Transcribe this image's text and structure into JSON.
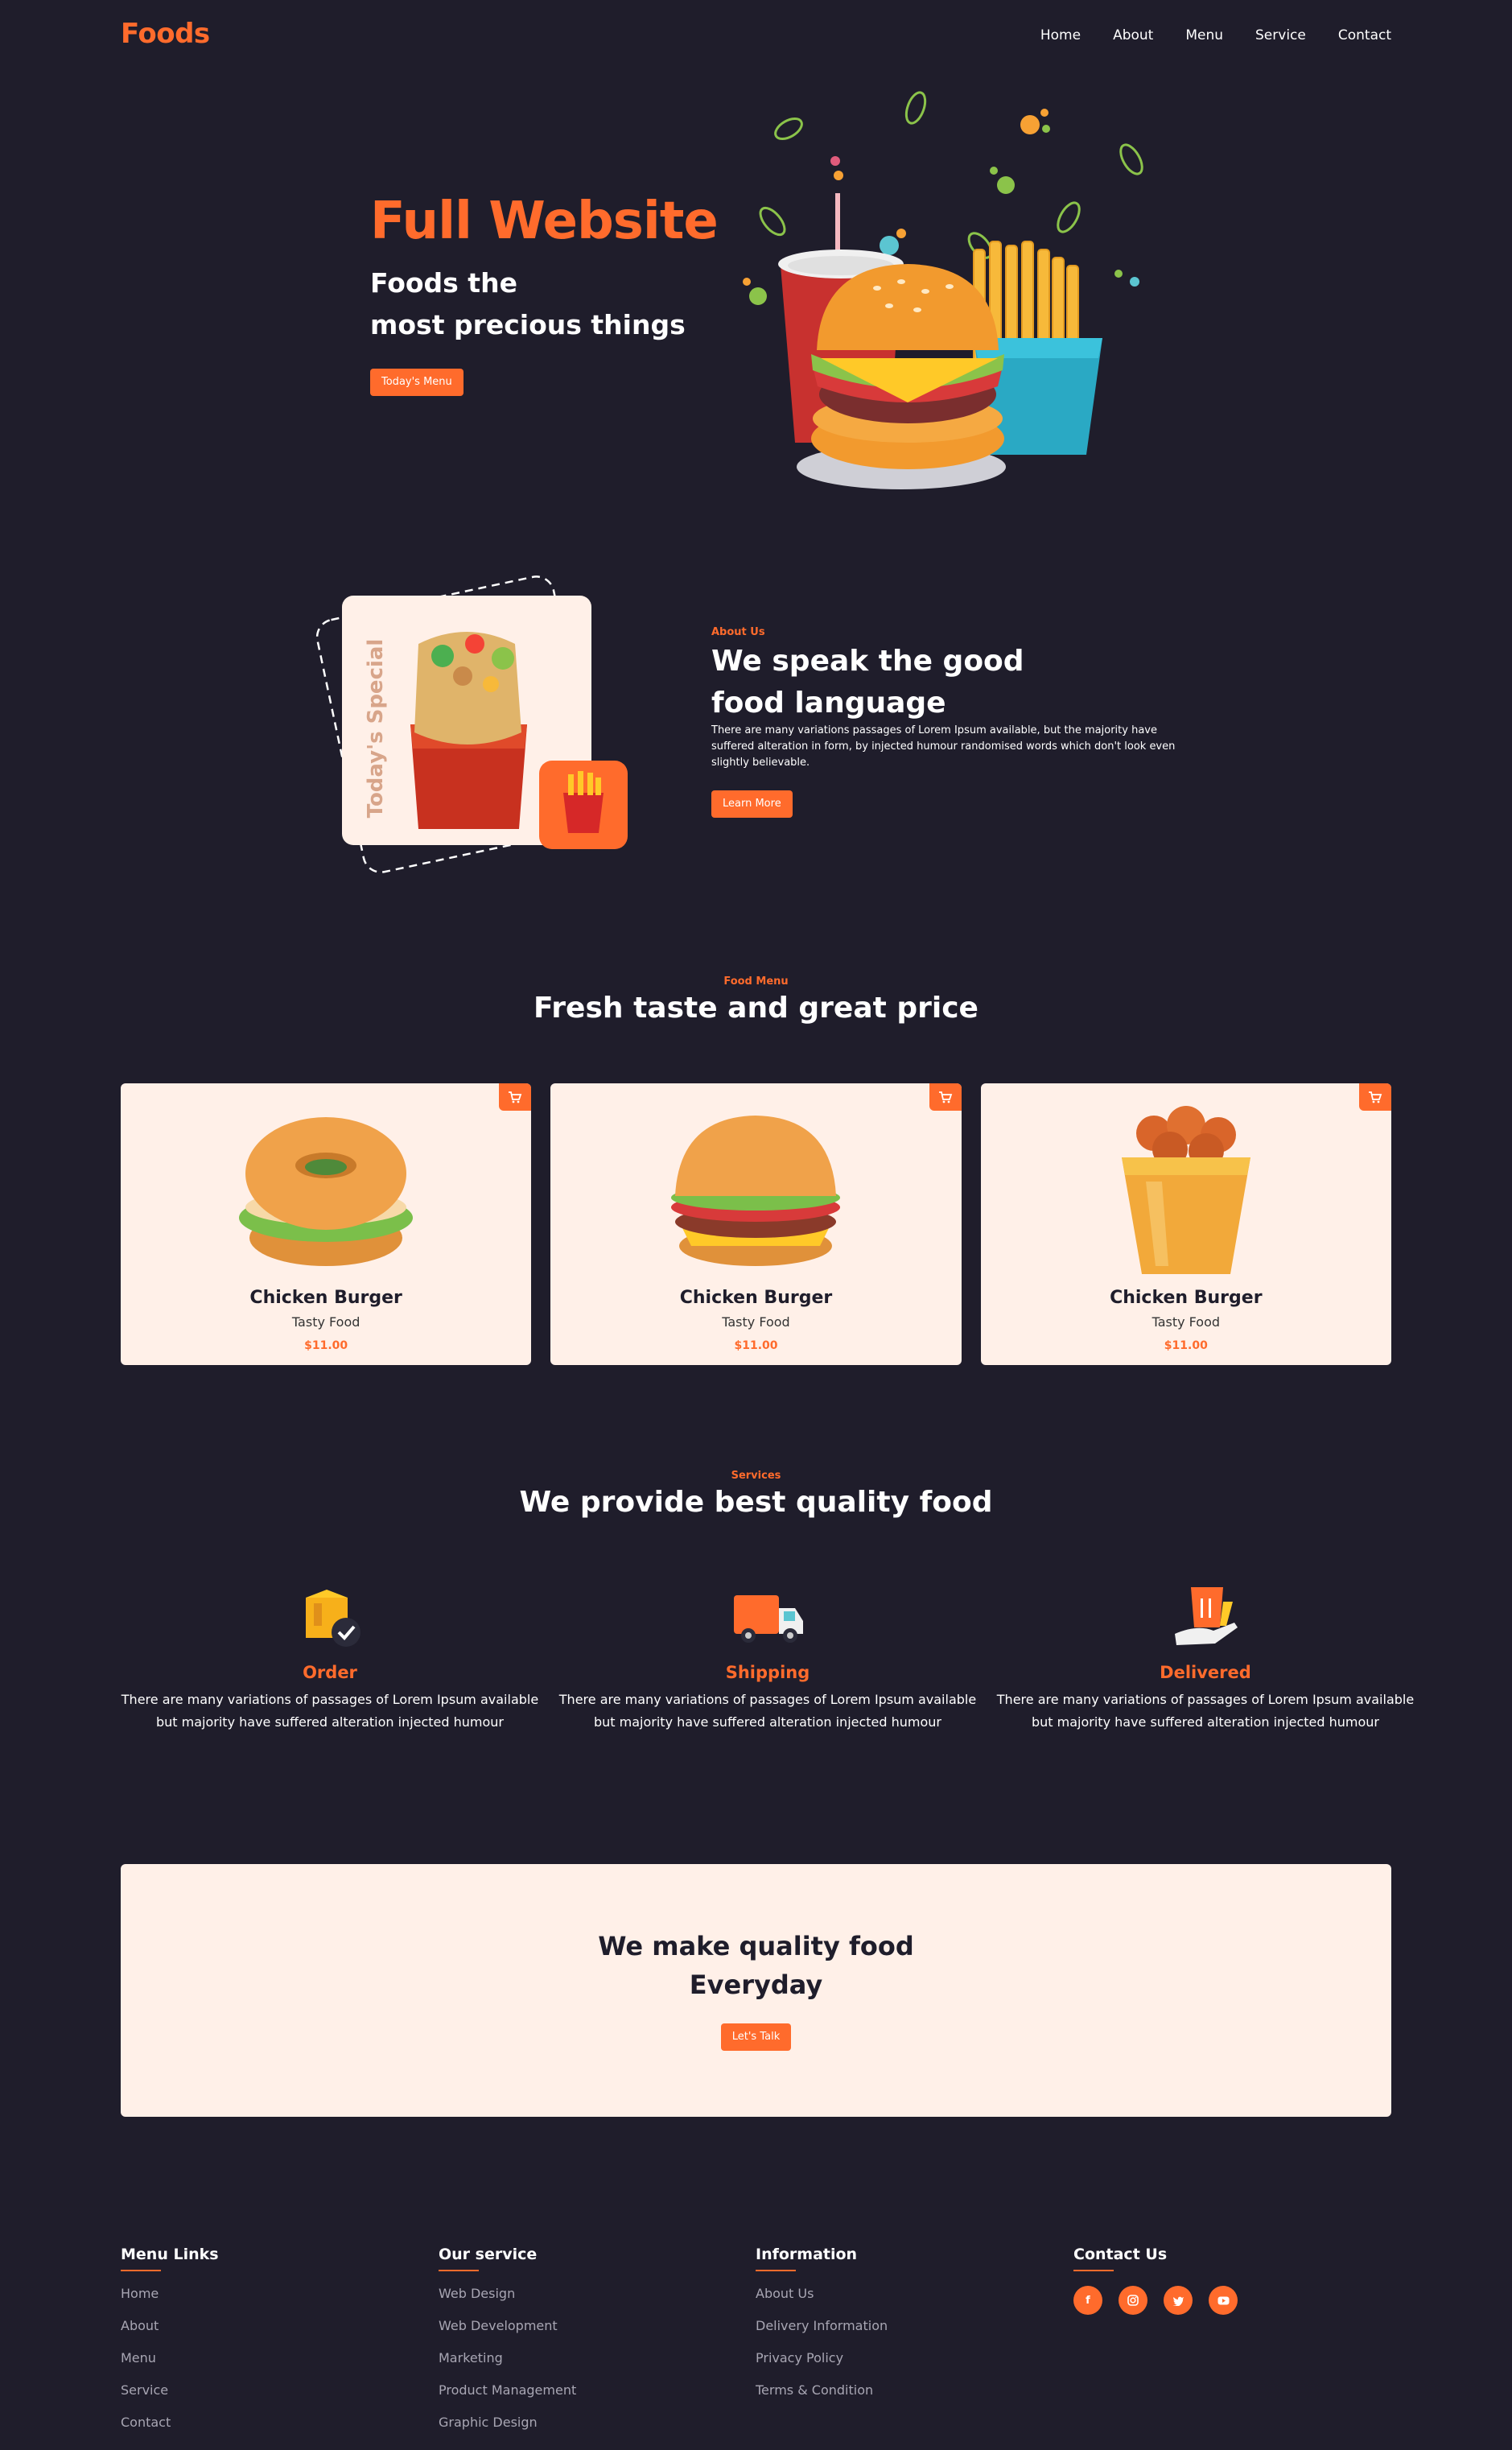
{
  "brand": {
    "logo": "Foods"
  },
  "nav": {
    "items": [
      "Home",
      "About",
      "Menu",
      "Service",
      "Contact"
    ]
  },
  "hero": {
    "title": "Full Website",
    "subtitle_line1": "Foods the",
    "subtitle_line2": "most precious things",
    "button": "Today's Menu"
  },
  "about": {
    "badge_text": "Today's Special",
    "label": "About Us",
    "title_line1": "We speak the good",
    "title_line2": "food language",
    "text": "There are many variations passages of Lorem Ipsum available, but the majority have suffered alteration in form, by injected humour randomised words which don't look even slightly believable.",
    "button": "Learn More"
  },
  "menu": {
    "label": "Food Menu",
    "title": "Fresh taste and great price",
    "items": [
      {
        "name": "Chicken Burger",
        "sub": "Tasty Food",
        "price": "$11.00",
        "image": "bagel-burger-illustration"
      },
      {
        "name": "Chicken Burger",
        "sub": "Tasty Food",
        "price": "$11.00",
        "image": "cheese-burger-illustration"
      },
      {
        "name": "Chicken Burger",
        "sub": "Tasty Food",
        "price": "$11.00",
        "image": "fried-chicken-bucket-illustration"
      }
    ]
  },
  "services": {
    "label": "Services",
    "title": "We provide best quality food",
    "items": [
      {
        "title": "Order",
        "icon": "order-box-icon",
        "text": "There are many variations of passages of Lorem Ipsum available but majority have suffered alteration injected humour"
      },
      {
        "title": "Shipping",
        "icon": "delivery-truck-icon",
        "text": "There are many variations of passages of Lorem Ipsum available but majority have suffered alteration injected humour"
      },
      {
        "title": "Delivered",
        "icon": "food-bag-hand-icon",
        "text": "There are many variations of passages of Lorem Ipsum available but majority have suffered alteration injected humour"
      }
    ]
  },
  "cta": {
    "title_line1": "We make quality food",
    "title_line2": "Everyday",
    "button": "Let's Talk"
  },
  "footer": {
    "menu_links": {
      "title": "Menu Links",
      "items": [
        "Home",
        "About",
        "Menu",
        "Service",
        "Contact"
      ]
    },
    "our_service": {
      "title": "Our service",
      "items": [
        "Web Design",
        "Web Development",
        "Marketing",
        "Product Management",
        "Graphic Design"
      ]
    },
    "information": {
      "title": "Information",
      "items": [
        "About Us",
        "Delivery Information",
        "Privacy Policy",
        "Terms & Condition"
      ]
    },
    "contact": {
      "title": "Contact Us",
      "socials": [
        "f",
        "instagram-icon",
        "twitter-icon",
        "youtube-icon"
      ]
    }
  },
  "colors": {
    "accent": "#ff6b2c",
    "background": "#1f1d2b",
    "card": "#fff0e8"
  }
}
